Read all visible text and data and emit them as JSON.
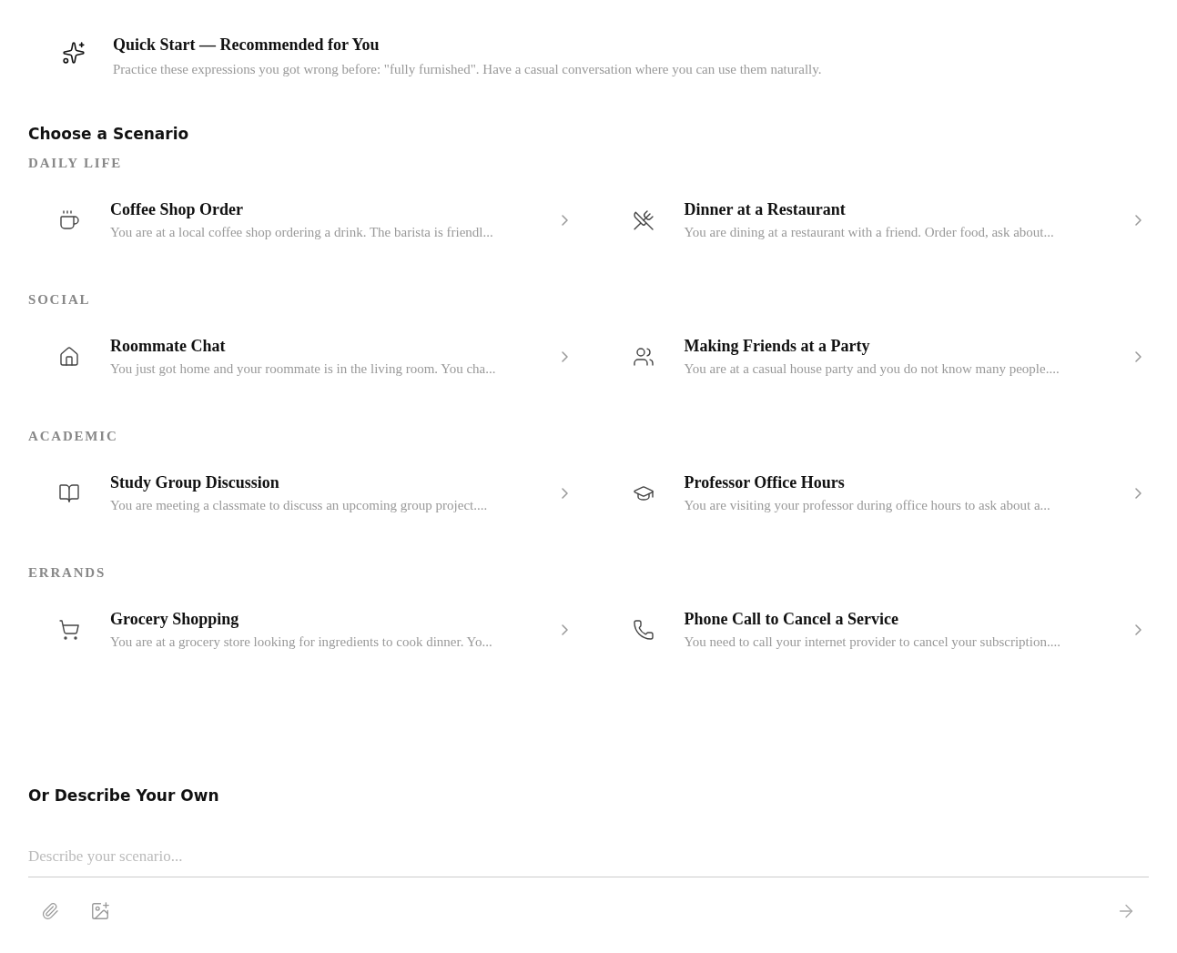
{
  "quick_start": {
    "title": "Quick Start — Recommended for You",
    "description": "Practice these expressions you got wrong before: \"fully furnished\". Have a casual conversation where you can use them naturally."
  },
  "scenarios": {
    "heading": "Choose a Scenario",
    "groups": [
      {
        "label": "DAILY LIFE",
        "items": [
          {
            "title": "Coffee Shop Order",
            "description": "You are at a local coffee shop ordering a drink. The barista is friendl..."
          },
          {
            "title": "Dinner at a Restaurant",
            "description": "You are dining at a restaurant with a friend. Order food, ask about..."
          }
        ]
      },
      {
        "label": "SOCIAL",
        "items": [
          {
            "title": "Roommate Chat",
            "description": "You just got home and your roommate is in the living room. You cha..."
          },
          {
            "title": "Making Friends at a Party",
            "description": "You are at a casual house party and you do not know many people...."
          }
        ]
      },
      {
        "label": "ACADEMIC",
        "items": [
          {
            "title": "Study Group Discussion",
            "description": "You are meeting a classmate to discuss an upcoming group project...."
          },
          {
            "title": "Professor Office Hours",
            "description": "You are visiting your professor during office hours to ask about a..."
          }
        ]
      },
      {
        "label": "ERRANDS",
        "items": [
          {
            "title": "Grocery Shopping",
            "description": "You are at a grocery store looking for ingredients to cook dinner. Yo..."
          },
          {
            "title": "Phone Call to Cancel a Service",
            "description": "You need to call your internet provider to cancel your subscription...."
          }
        ]
      }
    ]
  },
  "custom": {
    "heading": "Or Describe Your Own",
    "placeholder": "Describe your scenario..."
  }
}
